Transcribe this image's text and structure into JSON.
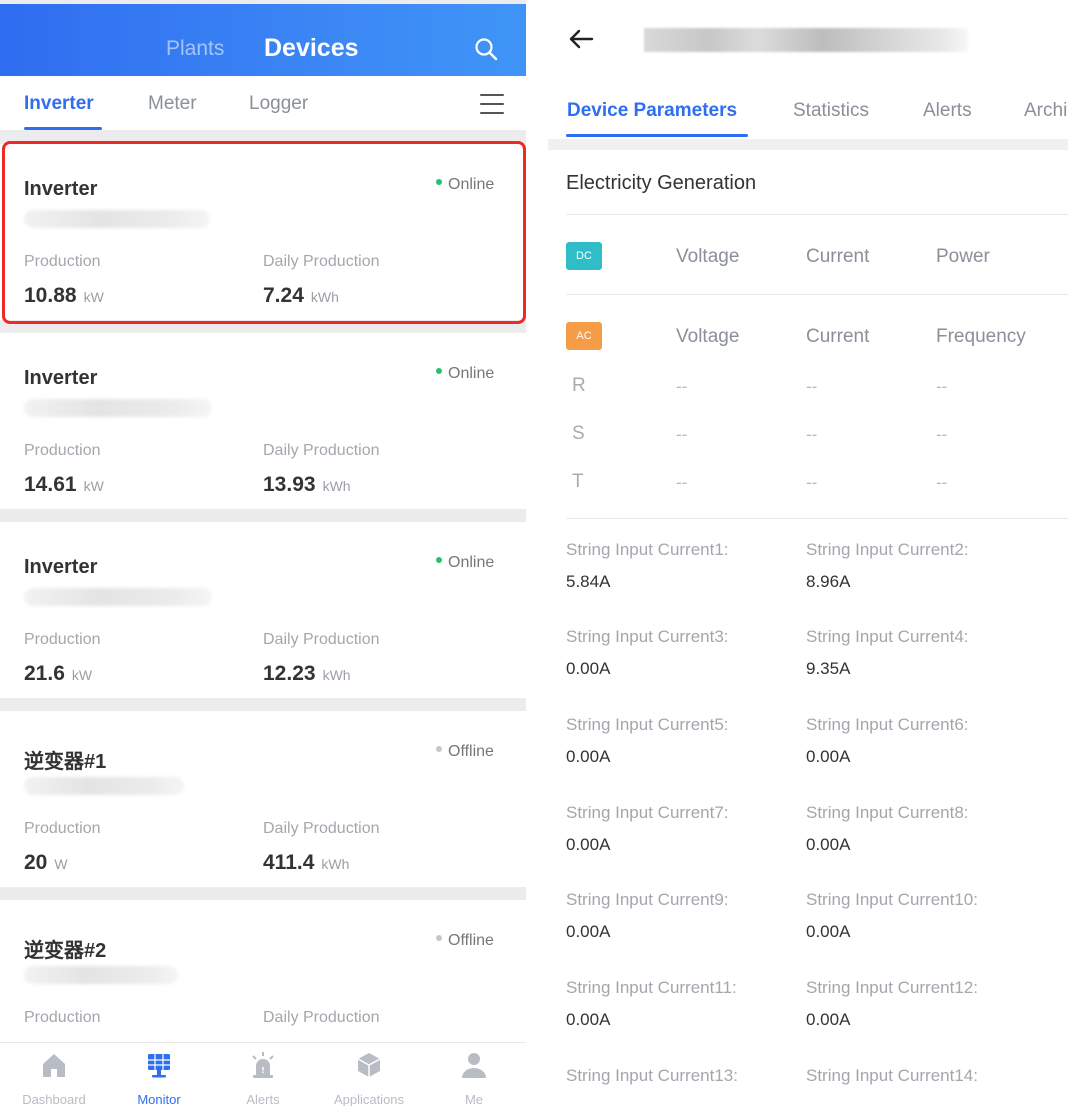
{
  "left": {
    "header": {
      "tab_plants": "Plants",
      "tab_devices": "Devices"
    },
    "subtabs": [
      "Inverter",
      "Meter",
      "Logger"
    ],
    "cards": [
      {
        "name": "Inverter",
        "status": "Online",
        "production_label": "Production",
        "production": "10.88",
        "production_unit": "kW",
        "daily_label": "Daily Production",
        "daily": "7.24",
        "daily_unit": "kWh"
      },
      {
        "name": "Inverter",
        "status": "Online",
        "production_label": "Production",
        "production": "14.61",
        "production_unit": "kW",
        "daily_label": "Daily Production",
        "daily": "13.93",
        "daily_unit": "kWh"
      },
      {
        "name": "Inverter",
        "status": "Online",
        "production_label": "Production",
        "production": "21.6",
        "production_unit": "kW",
        "daily_label": "Daily Production",
        "daily": "12.23",
        "daily_unit": "kWh"
      },
      {
        "name": "逆变器#1",
        "status": "Offline",
        "production_label": "Production",
        "production": "20",
        "production_unit": "W",
        "daily_label": "Daily Production",
        "daily": "411.4",
        "daily_unit": "kWh"
      },
      {
        "name": "逆变器#2",
        "status": "Offline",
        "production_label": "Production",
        "production": "",
        "production_unit": "",
        "daily_label": "Daily Production",
        "daily": "",
        "daily_unit": ""
      }
    ],
    "bottom_nav": [
      "Dashboard",
      "Monitor",
      "Alerts",
      "Applications",
      "Me"
    ],
    "colors": {
      "accent": "#2e6ef1",
      "online": "#27c26b",
      "offline": "#c4c7cc",
      "highlight": "#ee2a24"
    }
  },
  "right": {
    "tabs": [
      "Device Parameters",
      "Statistics",
      "Alerts",
      "Archi"
    ],
    "section_title": "Electricity Generation",
    "dc": {
      "badge": "DC",
      "columns": [
        "Voltage",
        "Current",
        "Power"
      ]
    },
    "ac": {
      "badge": "AC",
      "columns": [
        "Voltage",
        "Current",
        "Frequency"
      ],
      "rows": [
        {
          "label": "R",
          "values": [
            "--",
            "--",
            "--"
          ]
        },
        {
          "label": "S",
          "values": [
            "--",
            "--",
            "--"
          ]
        },
        {
          "label": "T",
          "values": [
            "--",
            "--",
            "--"
          ]
        }
      ]
    },
    "strings": [
      {
        "label": "String Input Current1:",
        "value": "5.84A"
      },
      {
        "label": "String Input Current2:",
        "value": "8.96A"
      },
      {
        "label": "String Input Current3:",
        "value": "0.00A"
      },
      {
        "label": "String Input Current4:",
        "value": "9.35A"
      },
      {
        "label": "String Input Current5:",
        "value": "0.00A"
      },
      {
        "label": "String Input Current6:",
        "value": "0.00A"
      },
      {
        "label": "String Input Current7:",
        "value": "0.00A"
      },
      {
        "label": "String Input Current8:",
        "value": "0.00A"
      },
      {
        "label": "String Input Current9:",
        "value": "0.00A"
      },
      {
        "label": "String Input Current10:",
        "value": "0.00A"
      },
      {
        "label": "String Input Current11:",
        "value": "0.00A"
      },
      {
        "label": "String Input Current12:",
        "value": "0.00A"
      },
      {
        "label": "String Input Current13:",
        "value": ""
      },
      {
        "label": "String Input Current14:",
        "value": ""
      }
    ]
  }
}
